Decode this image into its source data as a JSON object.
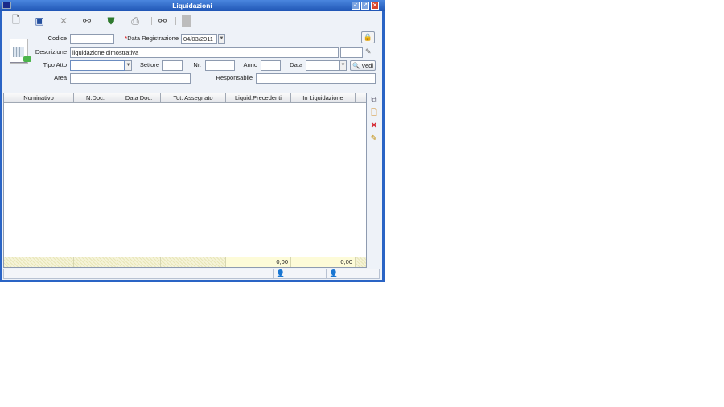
{
  "window": {
    "title": "Liquidazioni",
    "controls": [
      "minimize",
      "maximize",
      "close"
    ]
  },
  "toolbar": [
    "new-icon",
    "save-icon",
    "delete-icon",
    "search-icon",
    "shield-icon",
    "print-icon",
    "search-multi-icon",
    "document-icon"
  ],
  "form": {
    "codice_label": "Codice",
    "codice_value": "",
    "data_reg_required": "*",
    "data_reg_label": "Data Registrazione",
    "data_reg_value": "04/03/2011",
    "descrizione_label": "Descrizione",
    "descrizione_value": "liquidazione dimostrativa",
    "tipo_atto_label": "Tipo Atto",
    "settore_label": "Settore",
    "nr_label": "Nr.",
    "anno_label": "Anno",
    "data_label": "Data",
    "vedi_label": "Vedi",
    "area_label": "Area",
    "responsabile_label": "Responsabile"
  },
  "grid": {
    "columns": [
      "Nominativo",
      "N.Doc.",
      "Data Doc.",
      "Tot. Assegnato",
      "Liquid.Precedenti",
      "In Liquidazione"
    ],
    "rows": [],
    "totals": {
      "liquid_precedenti": "0,00",
      "in_liquidazione": "0,00"
    }
  },
  "side_actions": [
    "view-icon",
    "add-icon",
    "remove-icon",
    "edit-icon"
  ]
}
